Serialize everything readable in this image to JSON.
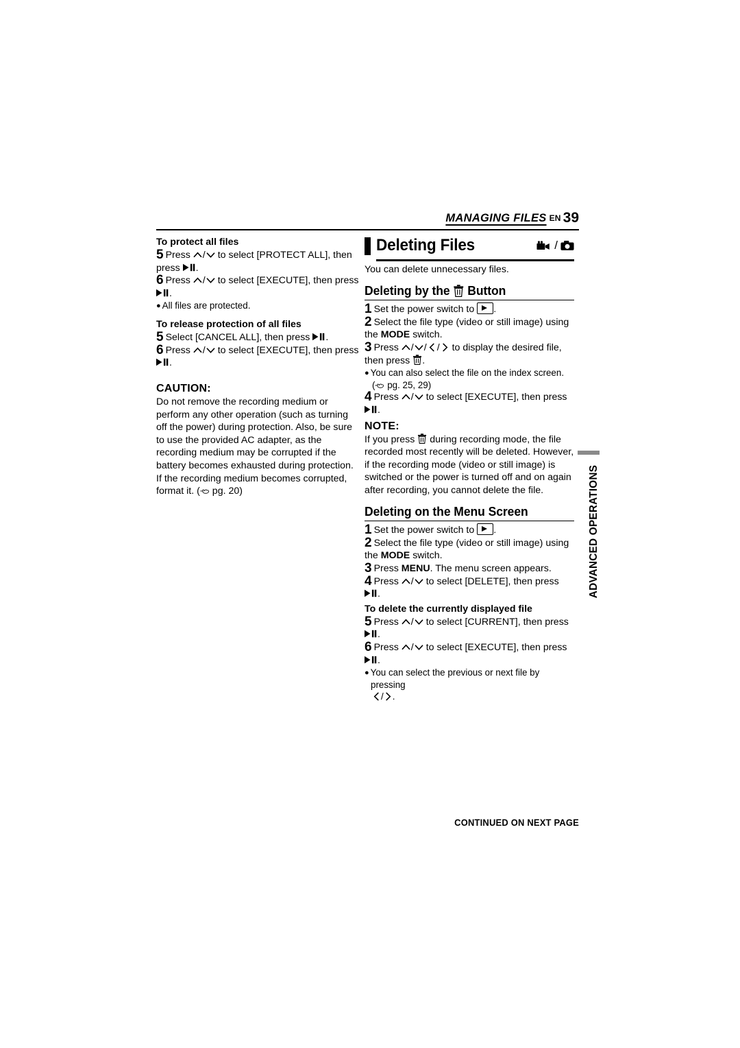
{
  "header": {
    "chapter": "MANAGING FILES",
    "en": "EN",
    "page_number": "39"
  },
  "left_column": {
    "protect_all": {
      "heading": "To protect all files",
      "steps": [
        {
          "num": "5",
          "pre": "Press",
          "mid": "to select [PROTECT ALL], then",
          "post": "press",
          "end": "."
        },
        {
          "num": "6",
          "pre": "Press",
          "mid": "to select [EXECUTE], then",
          "post": "press",
          "end": "."
        }
      ],
      "bullet": "All files are protected."
    },
    "release_protection": {
      "heading": "To release protection of all files",
      "step5_pre": "Select [CANCEL ALL], then press",
      "step5_end": ".",
      "step6_pre": "Press",
      "step6_mid": "to select [EXECUTE], then",
      "step6_post": "press",
      "step6_end": "."
    },
    "caution": {
      "title": "CAUTION:",
      "body_part1": "Do not remove the recording medium or perform any other operation (such as turning off the power) during protection. Also, be sure to use the provided AC adapter, as the recording medium may be corrupted if the battery becomes exhausted during protection. If the recording medium becomes corrupted, format it. (",
      "body_part2": " pg. 20)"
    }
  },
  "right_column": {
    "section": {
      "title": "Deleting Files",
      "intro": "You can delete unnecessary files.",
      "icons": [
        "camcorder-icon",
        "photo-camera-icon"
      ]
    },
    "delete_by_button": {
      "title_pre": "Deleting by the",
      "title_post": "Button",
      "steps": {
        "s1_pre": "Set the power switch to",
        "s1_end": ".",
        "s2": "Select the file type (video or still image) using the",
        "s2_bold": "MODE",
        "s2_end": "switch.",
        "s3_pre": "Press",
        "s3_mid": "to display the desired file, then press",
        "s3_end": ".",
        "s3_bullet1": "You can also select the file on the index screen.",
        "s3_bullet2": " pg. 25, 29)",
        "s4_pre": "Press",
        "s4_mid": "to select [EXECUTE], then",
        "s4_post": "press",
        "s4_end": "."
      }
    },
    "note": {
      "title": "NOTE:",
      "body_pre": "If you press",
      "body_post": "during recording mode, the file recorded most recently will be deleted. However, if the recording mode (video or still image) is switched or the power is turned off and on again after recording, you cannot delete the file."
    },
    "delete_on_menu": {
      "title": "Deleting on the Menu Screen",
      "steps": {
        "s1_pre": "Set the power switch to",
        "s1_end": ".",
        "s2": "Select the file type (video or still image) using the",
        "s2_bold": "MODE",
        "s2_end": "switch.",
        "s3_pre": "Press",
        "s3_bold": "MENU",
        "s3_post": ". The menu screen appears.",
        "s4_pre": "Press",
        "s4_mid": "to select [DELETE], then press",
        "s4_end": "."
      },
      "current_file": {
        "heading": "To delete the currently displayed file",
        "s5_pre": "Press",
        "s5_mid": "to select [CURRENT], then",
        "s5_post": "press",
        "s5_end": ".",
        "s6_pre": "Press",
        "s6_mid": "to select [EXECUTE], then",
        "s6_post": "press",
        "s6_end": ".",
        "bullet": "You can select the previous or next file by pressing",
        "bullet_end": "."
      }
    }
  },
  "side_tab": {
    "label": "ADVANCED OPERATIONS",
    "bar_color": "#8a8a8a"
  },
  "footer": {
    "text": "CONTINUED ON NEXT PAGE"
  }
}
